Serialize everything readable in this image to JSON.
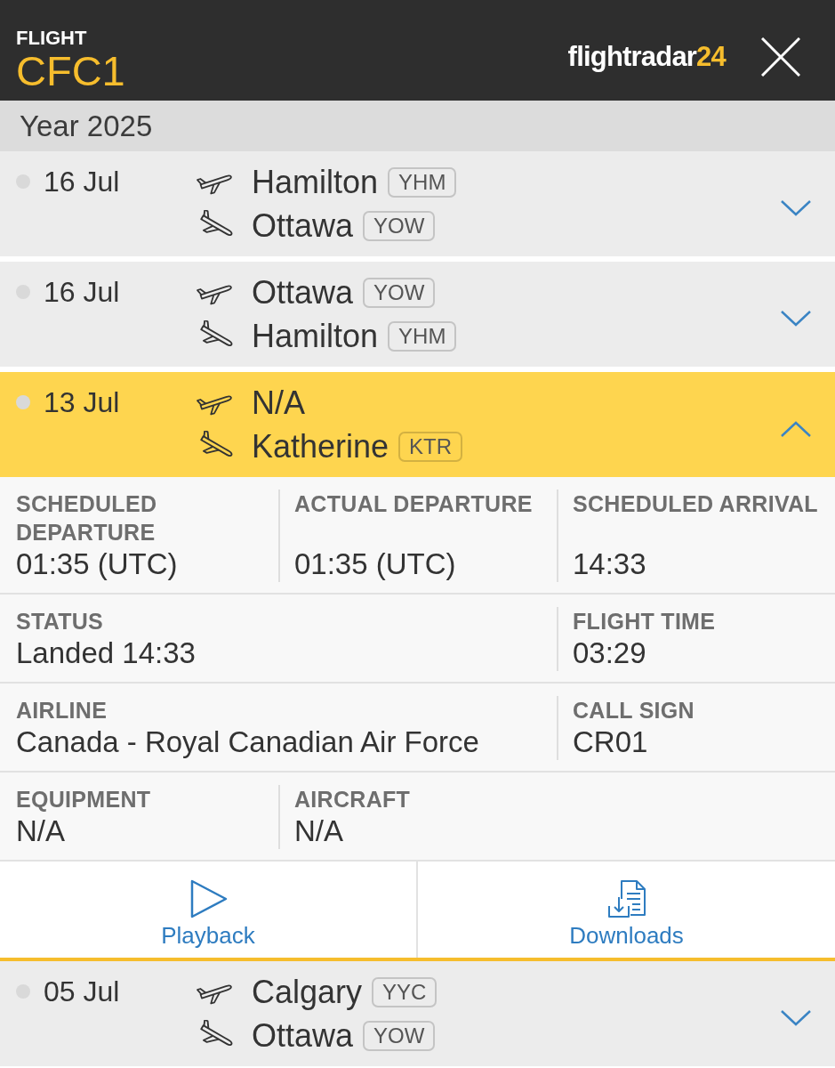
{
  "header": {
    "label": "FLIGHT",
    "flight_number": "CFC1",
    "logo": {
      "word": "flightradar",
      "number": "24"
    }
  },
  "year_bar": {
    "label": "Year 2025"
  },
  "flights": [
    {
      "date": "16 Jul",
      "departure": {
        "city": "Hamilton",
        "code": "YHM"
      },
      "arrival": {
        "city": "Ottawa",
        "code": "YOW"
      },
      "expanded": false
    },
    {
      "date": "16 Jul",
      "departure": {
        "city": "Ottawa",
        "code": "YOW"
      },
      "arrival": {
        "city": "Hamilton",
        "code": "YHM"
      },
      "expanded": false
    },
    {
      "date": "13 Jul",
      "departure": {
        "city": "N/A"
      },
      "arrival": {
        "city": "Katherine",
        "code": "KTR"
      },
      "expanded": true,
      "details": [
        [
          {
            "label": "SCHEDULED DEPARTURE",
            "value": "01:35 (UTC)"
          },
          {
            "label": "ACTUAL DEPARTURE",
            "value": "01:35 (UTC)"
          },
          {
            "label": "SCHEDULED ARRIVAL",
            "value": "14:33"
          }
        ],
        [
          {
            "label": "STATUS",
            "value": "Landed 14:33"
          },
          {
            "label": "FLIGHT TIME",
            "value": "03:29"
          }
        ],
        [
          {
            "label": "AIRLINE",
            "value": "Canada - Royal Canadian Air Force"
          },
          {
            "label": "CALL SIGN",
            "value": "CR01"
          }
        ],
        [
          {
            "label": "EQUIPMENT",
            "value": "N/A"
          },
          {
            "label": "AIRCRAFT",
            "value": "N/A"
          }
        ]
      ],
      "actions": [
        {
          "kind": "playback",
          "label": "Playback"
        },
        {
          "kind": "downloads",
          "label": "Downloads"
        }
      ]
    },
    {
      "date": "05 Jul",
      "departure": {
        "city": "Calgary",
        "code": "YYC"
      },
      "arrival": {
        "city": "Ottawa",
        "code": "YOW"
      },
      "expanded": false
    }
  ]
}
